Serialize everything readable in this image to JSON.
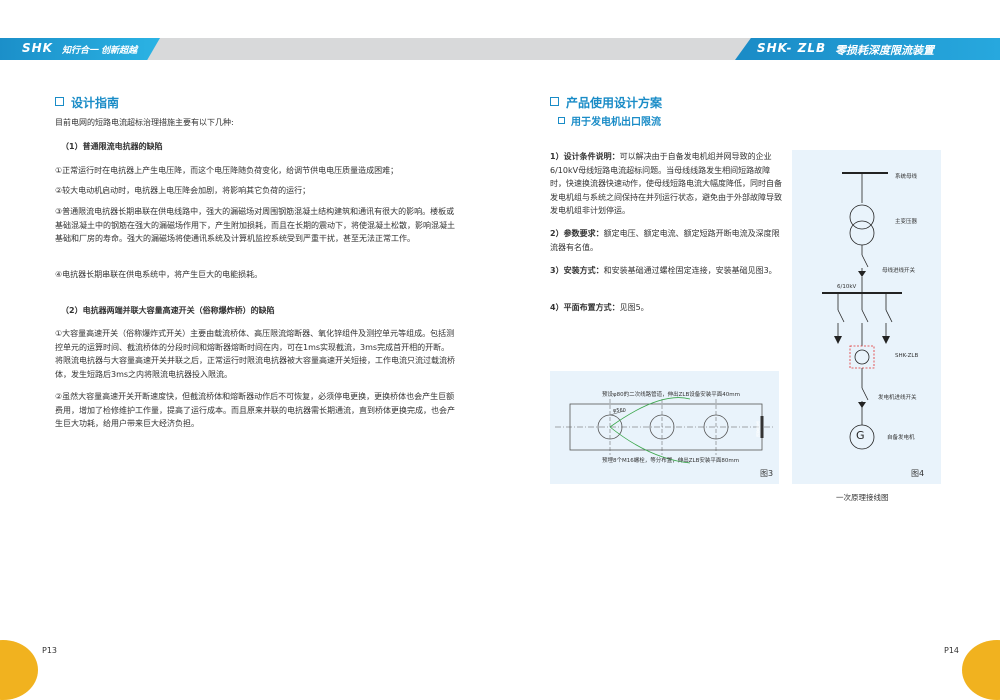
{
  "header": {
    "left_logo": "SHK",
    "left_slogan": "知行合一 创新超越",
    "right_logo": "SHK- ZLB",
    "right_title": "零损耗深度限流装置"
  },
  "left": {
    "section_title": "设计指南",
    "intro": "目前电网的短路电流超标治理措施主要有以下几种:",
    "sub1": "（1）普通限流电抗器的缺陷",
    "p1": "①正常运行时在电抗器上产生电压降，而这个电压降随负荷变化，给调节供电电压质量造成困难；",
    "p2": "②较大电动机启动时，电抗器上电压降会加剧，将影响其它负荷的运行；",
    "p3": "③普通限流电抗器长期串联在供电线路中，强大的漏磁场对周围钢筋混凝土结构建筑和通讯有很大的影响。楼板或基础混凝土中的钢筋在强大的漏磁场作用下，产生附加损耗，而且在长期的震动下，将使混凝土松散，影响混凝土基础和厂房的寿命。强大的漏磁场将使通讯系统及计算机监控系统受到严重干扰，甚至无法正常工作。",
    "p4": "④电抗器长期串联在供电系统中，将产生巨大的电能损耗。",
    "sub2": "（2）电抗器两端并联大容量高速开关（俗称爆炸桥）的缺陷",
    "p5": "①大容量高速开关（俗称爆炸式开关）主要由载流桥体、高压限流熔断器、氧化锌组件及测控单元等组成。包括测控单元的运算时间、截流桥体的分段时间和熔断器熔断时间在内，可在1ms实现截流，3ms完成首开相的开断。将限流电抗器与大容量高速开关并联之后，正常运行时限流电抗器被大容量高速开关短接，工作电流只流过载流桥体，发生短路后3ms之内将限流电抗器投入限流。",
    "p6": "②虽然大容量高速开关开断速度快，但截流桥体和熔断器动作后不可恢复，必须停电更换，更换桥体也会产生巨额费用，增加了检修维护工作量，提高了运行成本。而且原来并联的电抗器需长期通流，直到桥体更换完成，也会产生巨大功耗，给用户带来巨大经济负担。",
    "page": "P13"
  },
  "right": {
    "section_title": "产品使用设计方案",
    "sub_title": "用于发电机出口限流",
    "item1_label": "1）设计条件说明：",
    "item1_text": "可以解决由于自备发电机组并网导致的企业6/10kV母线短路电流超标问题。当母线线路发生相间短路故障时，快速换流器快速动作，使母线短路电流大幅度降低，同时自备发电机组与系统之间保持在并列运行状态，避免由于外部故障导致发电机组非计划停运。",
    "item2_label": "2）参数要求：",
    "item2_text": "额定电压、额定电流、额定短路开断电流及深度限流器有名值。",
    "item3_label": "3）安装方式：",
    "item3_text": "和安装基础通过螺栓固定连接，安装基础见图3。",
    "item4_label": "4）平面布置方式：",
    "item4_text": "见图5。",
    "fig3": {
      "top_note": "预设φ80的二次线路管道，伸出ZLB设备安装平面40mm",
      "dim": "φ560",
      "bottom_note": "预埋8个M16螺栓，等分布置，伸出ZLB安装平面80mm",
      "side_text": "安装基础",
      "caption": "图3"
    },
    "fig4": {
      "labels": [
        "系统母线",
        "主变压器",
        "母线进线开关",
        "6/10kV",
        "SHK-ZLB",
        "发电机进线开关",
        "自备发电机"
      ],
      "gen_symbol": "G",
      "caption": "图4",
      "below_caption": "一次原理接线图"
    },
    "page": "P14"
  },
  "colors": {
    "accent": "#1a8cc7",
    "band": "#d8d9da",
    "corner": "#f1b21f"
  }
}
